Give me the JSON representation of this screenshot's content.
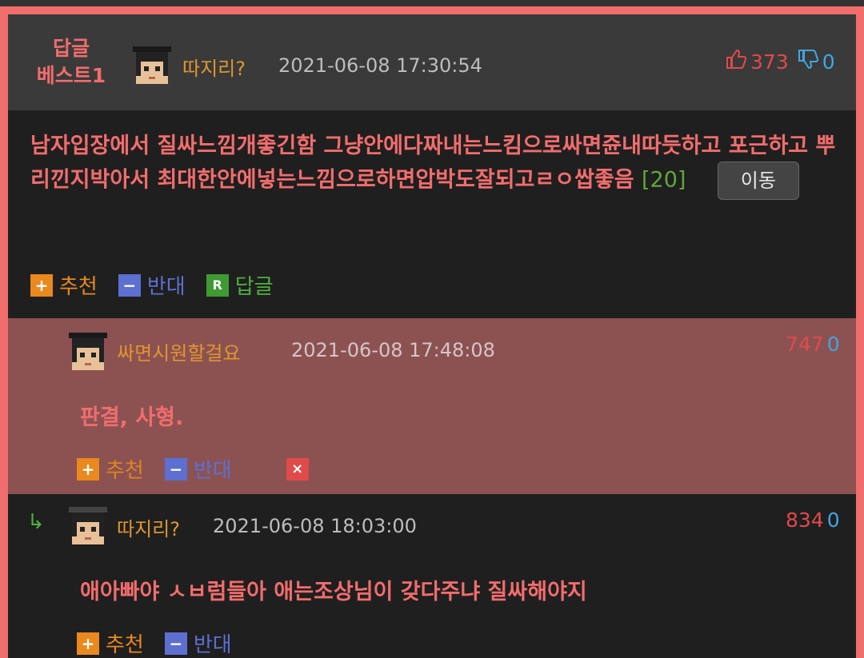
{
  "best": {
    "tag_line1": "답글",
    "tag_line2": "베스트1",
    "nick": "따지리?",
    "date": "2021-06-08 17:30:54",
    "up_count": "373",
    "down_count": "0",
    "body": "남자입장에서 질싸느낌개좋긴함 그냥안에다짜내는느킴으로싸면쥰내따듯하고 포근하고 뿌리낀지박아서 최대한안에넣는느낌으로하면압박도잘되고ㄹㅇ쌉좋음",
    "reply_count": "[20]",
    "move_label": "이동",
    "actions": {
      "recommend": "추천",
      "oppose": "반대",
      "reply": "답글",
      "reply_icon": "R"
    }
  },
  "replies": [
    {
      "nick": "싸면시원할걸요",
      "date": "2021-06-08 17:48:08",
      "up_count": "747",
      "down_count": "0",
      "body": "판결, 사형.",
      "actions": {
        "recommend": "추천",
        "oppose": "반대",
        "delete": "×"
      }
    },
    {
      "nick": "따지리?",
      "date": "2021-06-08 18:03:00",
      "up_count": "834",
      "down_count": "0",
      "body": "애아빠야 ㅅㅂ럼들아 애는조상님이 갖다주냐 질싸해야지",
      "actions": {
        "recommend": "추천",
        "oppose": "반대"
      }
    }
  ],
  "icons": {
    "plus": "+",
    "minus": "−",
    "reply_arrow": "↳"
  },
  "colors": {
    "accent_red": "#f26d6d",
    "nick_orange": "#e0962f",
    "up_red": "#e04a4a",
    "down_blue": "#3fa7e0"
  }
}
